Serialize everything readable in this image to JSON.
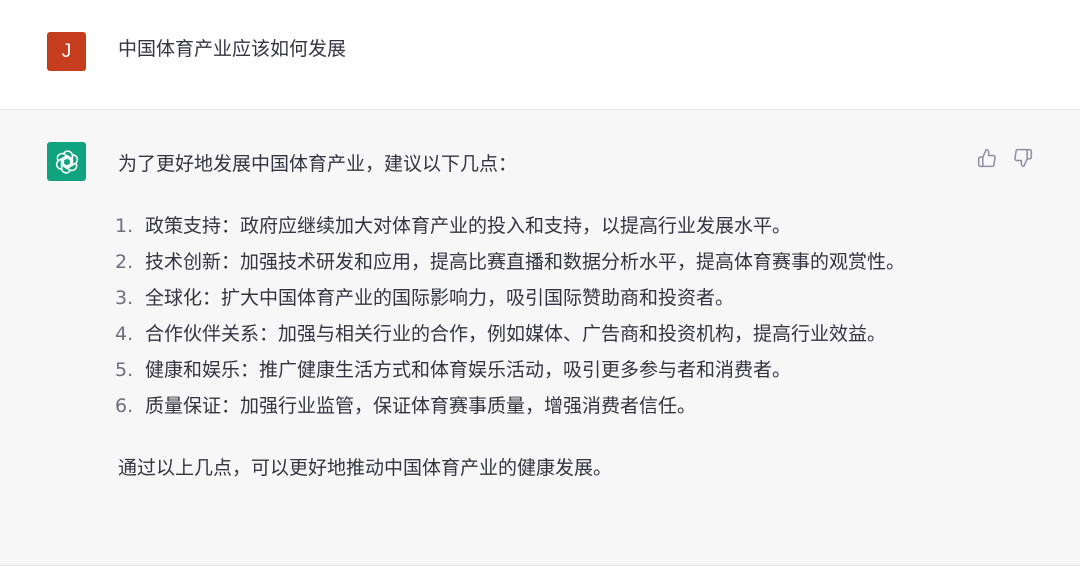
{
  "user_message": {
    "avatar_initial": "J",
    "text": "中国体育产业应该如何发展"
  },
  "assistant_message": {
    "intro": "为了更好地发展中国体育产业，建议以下几点：",
    "points": [
      {
        "num": "1.",
        "text": "政策支持：政府应继续加大对体育产业的投入和支持，以提高行业发展水平。"
      },
      {
        "num": "2.",
        "text": "技术创新：加强技术研发和应用，提高比赛直播和数据分析水平，提高体育赛事的观赏性。"
      },
      {
        "num": "3.",
        "text": "全球化：扩大中国体育产业的国际影响力，吸引国际赞助商和投资者。"
      },
      {
        "num": "4.",
        "text": "合作伙伴关系：加强与相关行业的合作，例如媒体、广告商和投资机构，提高行业效益。"
      },
      {
        "num": "5.",
        "text": "健康和娱乐：推广健康生活方式和体育娱乐活动，吸引更多参与者和消费者。"
      },
      {
        "num": "6.",
        "text": "质量保证：加强行业监管，保证体育赛事质量，增强消费者信任。"
      }
    ],
    "outro": "通过以上几点，可以更好地推动中国体育产业的健康发展。"
  },
  "colors": {
    "user_avatar": "#c63d1e",
    "assistant_avatar": "#10a37f",
    "assistant_bg": "#f7f7f8",
    "text": "#343541"
  },
  "icons": {
    "assistant_avatar": "openai-logo-icon",
    "like": "thumbs-up-icon",
    "dislike": "thumbs-down-icon"
  }
}
